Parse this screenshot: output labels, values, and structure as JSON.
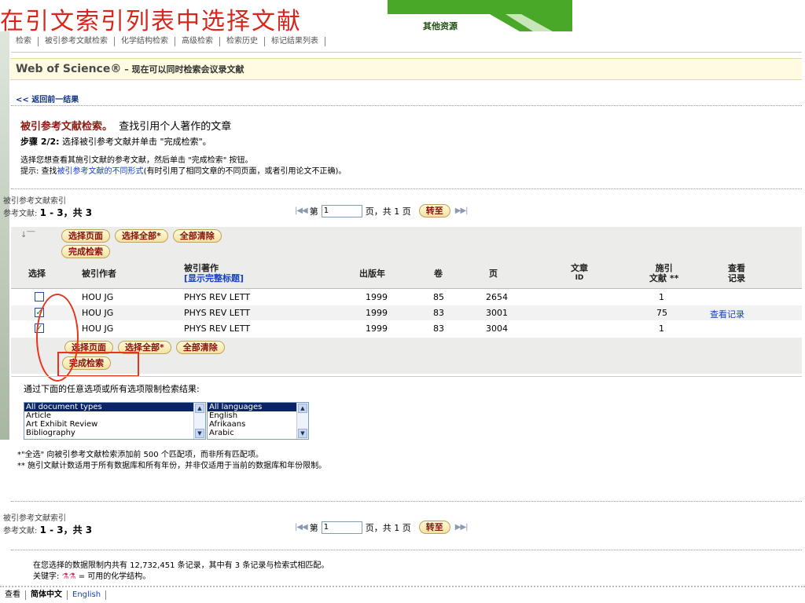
{
  "slide": {
    "title": "在引文索引列表中选择文献",
    "other_resources": "其他资源"
  },
  "nav": {
    "items": [
      "检索",
      "被引参考文献检索",
      "化学结构检索",
      "高级检索",
      "检索历史",
      "标记结果列表"
    ]
  },
  "header": {
    "title": "Web of Science®",
    "subtitle": " – 现在可以同时检索会议录文献"
  },
  "back_link": "<< 返回前一结果",
  "heading": {
    "bold": "被引参考文献检索。",
    "text": "查找引用个人著作的文章"
  },
  "step": {
    "bold": "步骤 2/2:",
    "text": " 选择被引参考文献并单击 \"完成检索\"。"
  },
  "instructions": {
    "line1": "选择您想查看其施引文献的参考文献，然后单击 \"完成检索\" 按钮。",
    "line2_pre": "提示: 查找",
    "line2_link": "被引参考文献的不同形式",
    "line2_post": "(有时引用了相同文章的不同页面，或者引用论文不正确)。"
  },
  "index": {
    "label": "被引参考文献索引",
    "refs_label": "参考文献:",
    "range": "1 - 3，共 3"
  },
  "pager": {
    "page_prefix": "第",
    "page_value": "1",
    "page_suffix": "页，共 1 页",
    "go": "转至"
  },
  "buttons": {
    "select_page": "选择页面",
    "select_all": "选择全部*",
    "clear_all": "全部清除",
    "finish": "完成检索"
  },
  "table": {
    "headers": {
      "select": "选择",
      "cited_author": "被引作者",
      "cited_work": "被引著作",
      "show_full_title": "[显示完整标题]",
      "year": "出版年",
      "volume": "卷",
      "page": "页",
      "article_id_1": "文章",
      "article_id_2": "ID",
      "citing_1": "施引",
      "citing_2": "文献 **",
      "view_1": "查看",
      "view_2": "记录"
    },
    "rows": [
      {
        "checked": false,
        "author": "HOU JG",
        "work": "PHYS REV LETT",
        "year": "1999",
        "volume": "85",
        "page": "2654",
        "article_id": "",
        "citing": "1",
        "view": ""
      },
      {
        "checked": true,
        "author": "HOU JG",
        "work": "PHYS REV LETT",
        "year": "1999",
        "volume": "83",
        "page": "3001",
        "article_id": "",
        "citing": "75",
        "view": "查看记录"
      },
      {
        "checked": true,
        "author": "HOU JG",
        "work": "PHYS REV LETT",
        "year": "1999",
        "volume": "83",
        "page": "3004",
        "article_id": "",
        "citing": "1",
        "view": ""
      }
    ]
  },
  "limits": {
    "label": "通过下面的任意选项或所有选项限制检索结果:",
    "doc_types": [
      "All document types",
      "Article",
      "Art Exhibit Review",
      "Bibliography"
    ],
    "languages": [
      "All languages",
      "English",
      "Afrikaans",
      "Arabic"
    ]
  },
  "notes": {
    "line1": "*\"全选\" 向被引参考文献检索添加前 500 个匹配项，而非所有匹配项。",
    "line2": "** 施引文献计数适用于所有数据库和所有年份，并非仅适用于当前的数据库和年份限制。"
  },
  "summary": {
    "line1": "在您选择的数据限制内共有 12,732,451 条记录，其中有 3 条记录与检索式相匹配。",
    "line2_pre": "关键字:",
    "line2_post": "= 可用的化学结构。"
  },
  "footer": {
    "view": "查看",
    "chinese": "简体中文",
    "english": "English"
  },
  "colors": {
    "title_red": "#d8261c",
    "green": "#4aa829",
    "annotation_red": "#e8341d",
    "link_blue": "#1540c8"
  }
}
